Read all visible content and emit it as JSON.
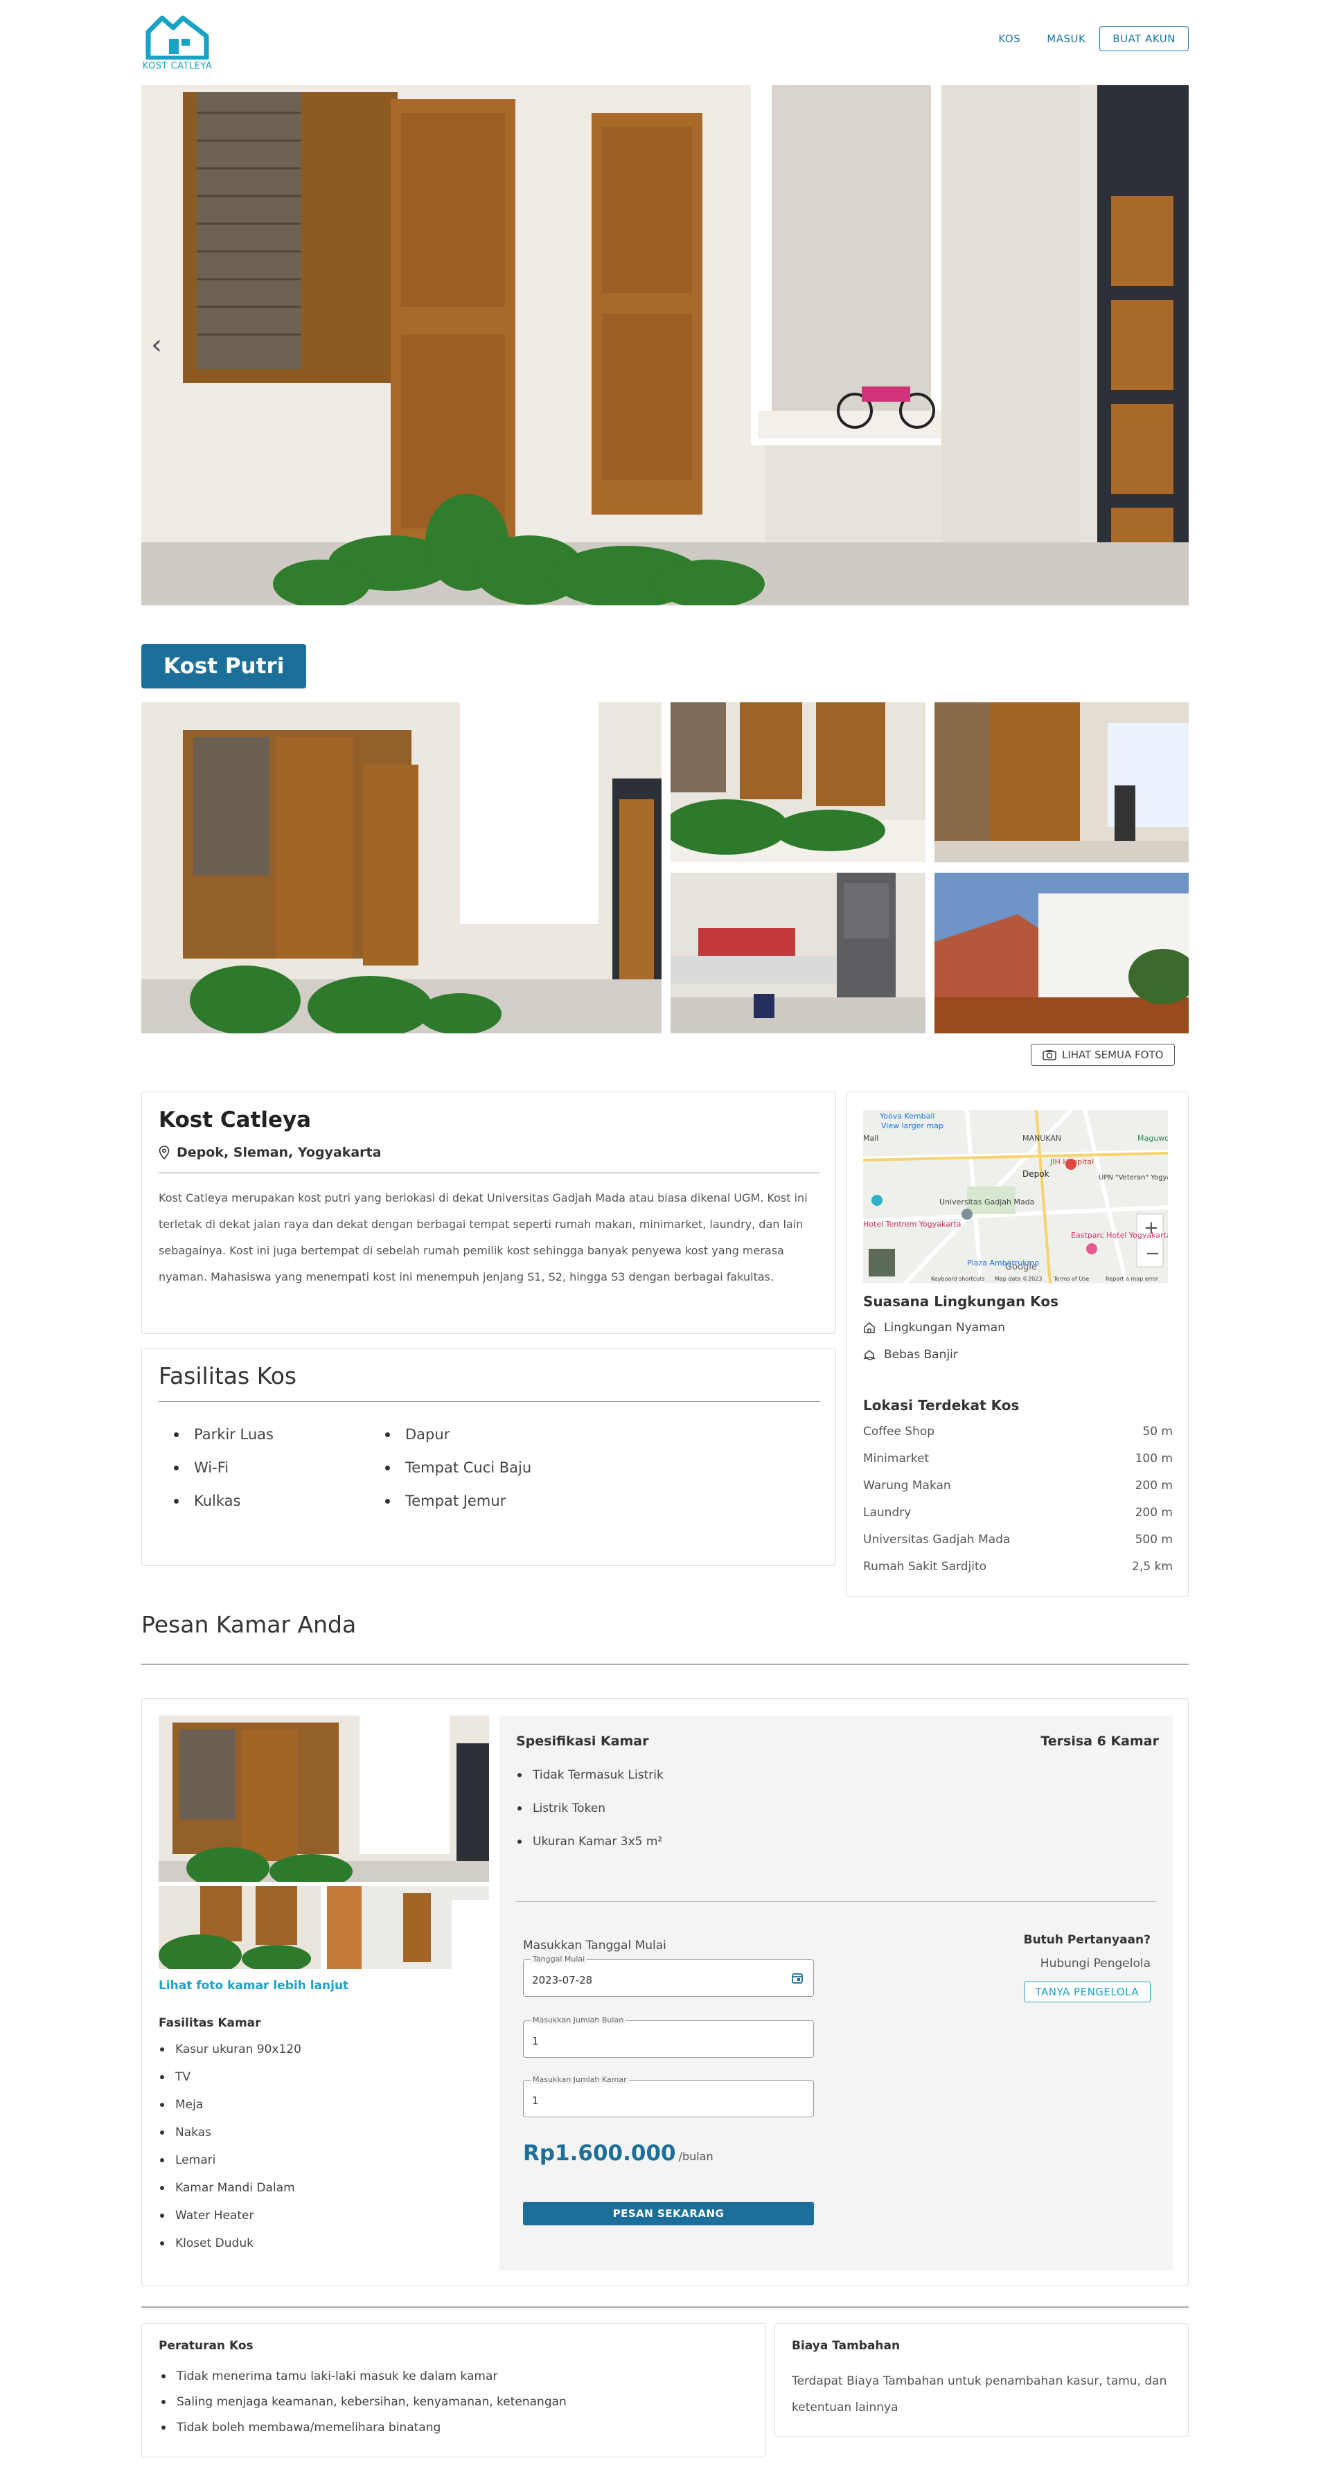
{
  "header": {
    "logo_text": "KOST CATLEYA",
    "nav": {
      "kos": "KOS",
      "masuk": "MASUK",
      "buat_akun": "BUAT AKUN"
    }
  },
  "badge": "Kost Putri",
  "see_all_photos": "LIHAT SEMUA FOTO",
  "property": {
    "name": "Kost Catleya",
    "location": "Depok, Sleman, Yogyakarta",
    "description": "Kost Catleya merupakan kost putri yang berlokasi di dekat Universitas Gadjah Mada atau biasa dikenal UGM. Kost ini terletak di dekat jalan raya dan dekat dengan berbagai tempat seperti rumah makan, minimarket, laundry, dan lain sebagainya. Kost ini juga bertempat di sebelah rumah pemilik kost sehingga banyak penyewa kost yang merasa nyaman. Mahasiswa yang menempati kost ini menempuh jenjang S1, S2, hingga S3 dengan berbagai fakultas."
  },
  "facilities": {
    "title": "Fasilitas Kos",
    "items": [
      "Parkir Luas",
      "Dapur",
      "Wi-Fi",
      "Tempat Cuci Baju",
      "Kulkas",
      "Tempat Jemur"
    ]
  },
  "map": {
    "labels": [
      "Yoova Kembali",
      "View larger map",
      "MANUKAN",
      "JIH Hospital",
      "Depok",
      "UPN \"Veteran\" Yogyakarta",
      "Universitas Gadjah Mada",
      "Hotel Tentrem Yogyakarta",
      "Eastparc Hotel Yogyakarta",
      "Plaza Ambarrukmo",
      "Keyboard shortcuts",
      "Map data ©2023",
      "Terms of Use",
      "Report a map error",
      "Google",
      "Maguwo",
      "Mall"
    ]
  },
  "environment": {
    "title": "Suasana Lingkungan Kos",
    "items": [
      "Lingkungan Nyaman",
      "Bebas Banjir"
    ]
  },
  "nearby": {
    "title": "Lokasi Terdekat Kos",
    "items": [
      {
        "name": "Coffee Shop",
        "dist": "50 m"
      },
      {
        "name": "Minimarket",
        "dist": "100 m"
      },
      {
        "name": "Warung Makan",
        "dist": "200 m"
      },
      {
        "name": "Laundry",
        "dist": "200 m"
      },
      {
        "name": "Universitas Gadjah Mada",
        "dist": "500 m"
      },
      {
        "name": "Rumah Sakit Sardjito",
        "dist": "2,5 km"
      }
    ]
  },
  "booking": {
    "title": "Pesan Kamar Anda",
    "more_photos": "Lihat foto kamar lebih lanjut",
    "room_fac_title": "Fasilitas Kamar",
    "room_facilities": [
      "Kasur ukuran 90x120",
      "TV",
      "Meja",
      "Nakas",
      "Lemari",
      "Kamar Mandi Dalam",
      "Water Heater",
      "Kloset Duduk"
    ],
    "spec_title": "Spesifikasi Kamar",
    "remaining": "Tersisa 6 Kamar",
    "specs": [
      "Tidak Termasuk Listrik",
      "Listrik Token",
      "Ukuran Kamar 3x5 m²"
    ],
    "start_label": "Masukkan Tanggal Mulai",
    "date_label": "Tanggal Mulai",
    "date_value": "2023-07-28",
    "months_label": "Masukkan Jumlah Bulan",
    "months_value": "1",
    "rooms_label": "Masukkan Jumlah Kamar",
    "rooms_value": "1",
    "price": "Rp1.600.000",
    "price_unit": "/bulan",
    "order_button": "PESAN SEKARANG",
    "question_title": "Butuh Pertanyaan?",
    "question_sub": "Hubungi Pengelola",
    "ask_button": "TANYA PENGELOLA"
  },
  "rules": {
    "title": "Peraturan Kos",
    "items": [
      "Tidak menerima tamu laki-laki masuk ke dalam kamar",
      "Saling menjaga keamanan, kebersihan, kenyamanan, ketenangan",
      "Tidak boleh membawa/memelihara binatang"
    ]
  },
  "extra": {
    "title": "Biaya Tambahan",
    "text": "Terdapat Biaya Tambahan untuk penambahan kasur, tamu, dan ketentuan lainnya"
  },
  "colors": {
    "primary": "#1b6f98",
    "accent": "#17a2c6"
  }
}
